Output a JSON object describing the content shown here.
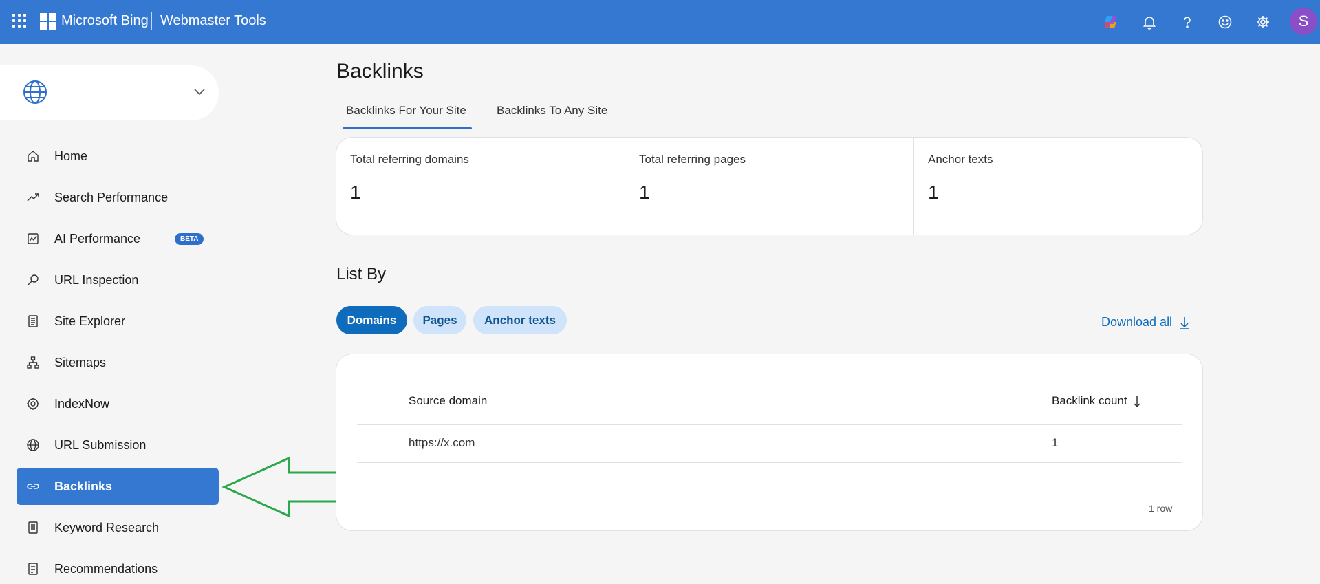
{
  "header": {
    "brand": "Microsoft Bing",
    "product": "Webmaster Tools",
    "avatar_initial": "S",
    "icons": [
      "app-launcher-icon",
      "copilot-icon",
      "bell-icon",
      "help-icon",
      "smiley-icon",
      "gear-icon"
    ]
  },
  "sidebar": {
    "items": [
      {
        "label": "Home",
        "icon": "home-icon"
      },
      {
        "label": "Search Performance",
        "icon": "trend-icon"
      },
      {
        "label": "AI Performance",
        "icon": "chart-icon",
        "badge": "BETA"
      },
      {
        "label": "URL Inspection",
        "icon": "search-icon"
      },
      {
        "label": "Site Explorer",
        "icon": "document-icon"
      },
      {
        "label": "Sitemaps",
        "icon": "sitemap-icon"
      },
      {
        "label": "IndexNow",
        "icon": "gear-icon"
      },
      {
        "label": "URL Submission",
        "icon": "globe-icon"
      },
      {
        "label": "Backlinks",
        "icon": "link-icon",
        "active": true
      },
      {
        "label": "Keyword Research",
        "icon": "document-icon"
      },
      {
        "label": "Recommendations",
        "icon": "checklist-icon"
      }
    ]
  },
  "main": {
    "title": "Backlinks",
    "tabs": [
      {
        "label": "Backlinks For Your Site",
        "active": true
      },
      {
        "label": "Backlinks To Any Site",
        "active": false
      }
    ],
    "stats": [
      {
        "label": "Total referring domains",
        "value": "1"
      },
      {
        "label": "Total referring pages",
        "value": "1"
      },
      {
        "label": "Anchor texts",
        "value": "1"
      }
    ],
    "list_by": {
      "title": "List By",
      "options": [
        {
          "label": "Domains",
          "active": true
        },
        {
          "label": "Pages",
          "active": false
        },
        {
          "label": "Anchor texts",
          "active": false
        }
      ],
      "download_label": "Download all"
    },
    "table": {
      "columns": [
        "Source domain",
        "Backlink count"
      ],
      "rows": [
        {
          "source": "https://x.com",
          "count": "1"
        }
      ],
      "row_count": "1 row"
    }
  },
  "colors": {
    "topbar": "#3578d1",
    "accent": "#0f6cbd",
    "active_nav": "#3578d1",
    "annotation_arrow": "#2aa84a"
  }
}
